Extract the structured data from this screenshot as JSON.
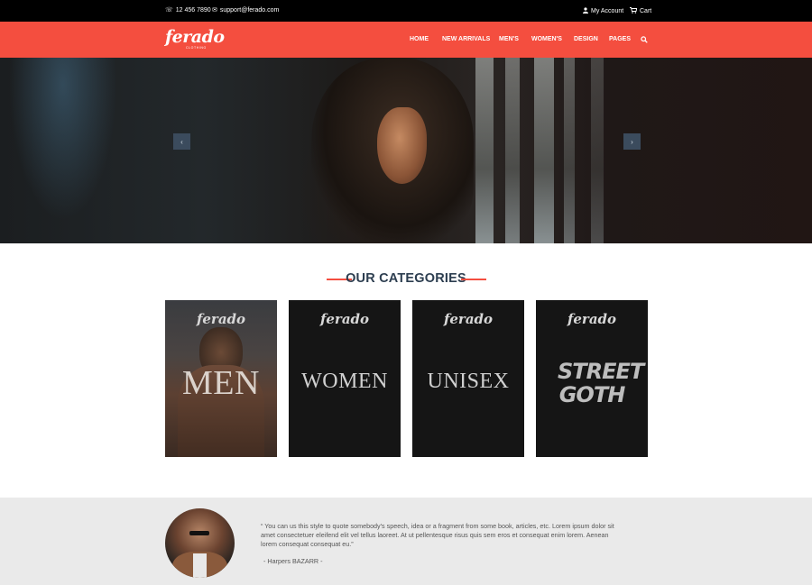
{
  "topbar": {
    "phone": "12 456 7890",
    "email": "support@ferado.com",
    "account": "My Account",
    "cart": "Cart",
    "phone_icon": "phone-icon",
    "email_icon": "envelope-icon",
    "account_icon": "user-icon",
    "cart_icon": "cart-icon"
  },
  "nav": {
    "logo": "ferado",
    "logo_sub": "CLOTHING",
    "items": [
      "HOME",
      "NEW ARRIVALS",
      "MEN'S",
      "WOMEN'S",
      "DESIGN",
      "PAGES"
    ],
    "search_icon": "search-icon"
  },
  "hero": {
    "prev": "‹",
    "next": "›"
  },
  "categories": {
    "title": "OUR CATEGORIES",
    "cards": [
      {
        "brand": "ferado",
        "label": "MEN"
      },
      {
        "brand": "ferado",
        "label": "WOMEN"
      },
      {
        "brand": "ferado",
        "label": "UNISEX"
      },
      {
        "brand": "ferado",
        "label": "STREET GOTH"
      }
    ]
  },
  "testimonial": {
    "quote": "“ You can us this style to quote somebody's speech, idea or a fragment from some book, articles, etc. Lorem ipsum dolor sit amet consectetuer eleifend elit vel tellus laoreet. At ut pellentesque risus quis sem eros et consequat enim lorem. Aenean lorem consequat consequat eu.”",
    "author": "- Harpers BAZARR -"
  },
  "colors": {
    "accent": "#f44e3f",
    "heading": "#2d3e50"
  }
}
